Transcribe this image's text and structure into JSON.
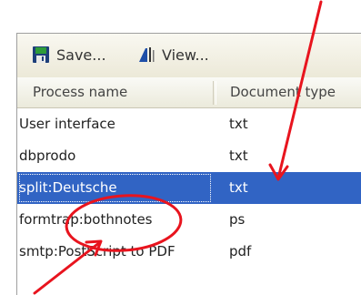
{
  "toolbar": {
    "save_label": "Save...",
    "view_label": "View...",
    "save_icon": "floppy-disk-icon",
    "view_icon": "view-document-icon"
  },
  "list": {
    "columns": [
      "Process name",
      "Document type"
    ],
    "rows": [
      {
        "process": "User interface",
        "doctype": "txt",
        "selected": false
      },
      {
        "process": "dbprodo",
        "doctype": "txt",
        "selected": false
      },
      {
        "process": "split:Deutsche",
        "doctype": "txt",
        "selected": true
      },
      {
        "process": "formtrap:bothnotes",
        "doctype": "ps",
        "selected": false
      },
      {
        "process": "smtp:PostScript to PDF",
        "doctype": "pdf",
        "selected": false
      }
    ]
  },
  "colors": {
    "selection": "#3164c4",
    "annotation": "#e8141e",
    "toolbar": "#ece9d8"
  }
}
